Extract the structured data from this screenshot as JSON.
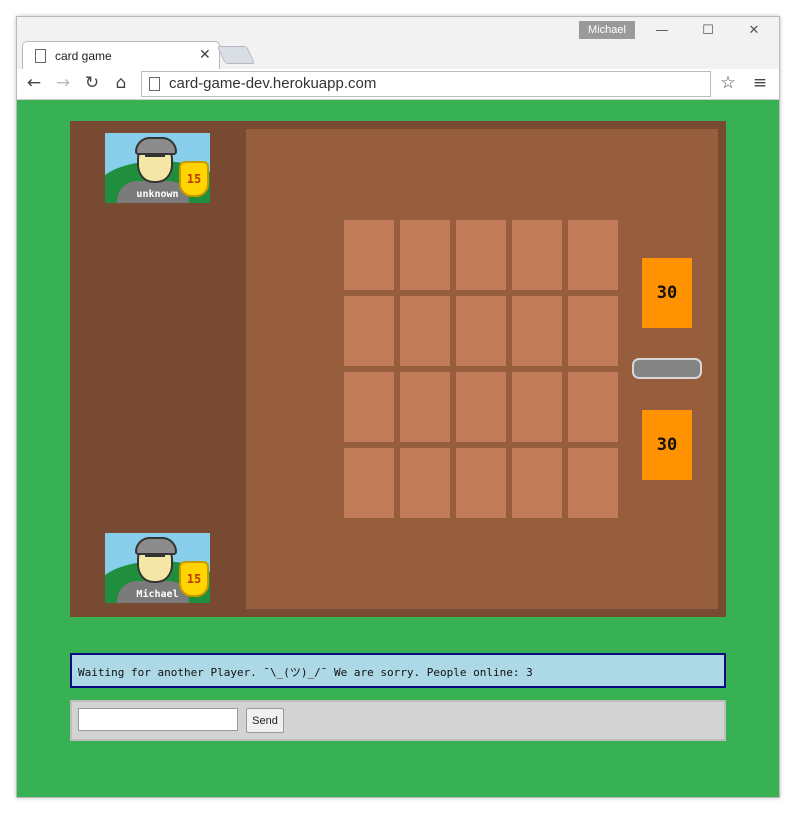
{
  "browser": {
    "profile_name": "Michael",
    "tab_title": "card game",
    "url": "card-game-dev.herokuapp.com",
    "icons": {
      "tab_page": "page-icon",
      "tab_close": "close-icon",
      "back": "back-arrow-icon",
      "forward": "forward-arrow-icon",
      "reload": "reload-icon",
      "home": "home-icon",
      "url_page": "page-icon",
      "bookmark": "star-icon",
      "menu": "menu-icon"
    },
    "window_buttons": {
      "minimize": "—",
      "maximize": "☐",
      "close": "✕"
    }
  },
  "game": {
    "opponent": {
      "name": "unknown",
      "level": "15"
    },
    "player": {
      "name": "Michael",
      "level": "15"
    },
    "opponent_score": "30",
    "player_score": "30",
    "colors": {
      "page_background": "#37b153",
      "board": "#784a31",
      "field": "#975e3e",
      "card": "#c27c5a",
      "score": "#ff9200"
    }
  },
  "status": {
    "message": "Waiting for another Player. ¯\\_(ツ)_/¯ We are sorry. People online: 3"
  },
  "chat": {
    "input_value": "",
    "send_label": "Send"
  }
}
